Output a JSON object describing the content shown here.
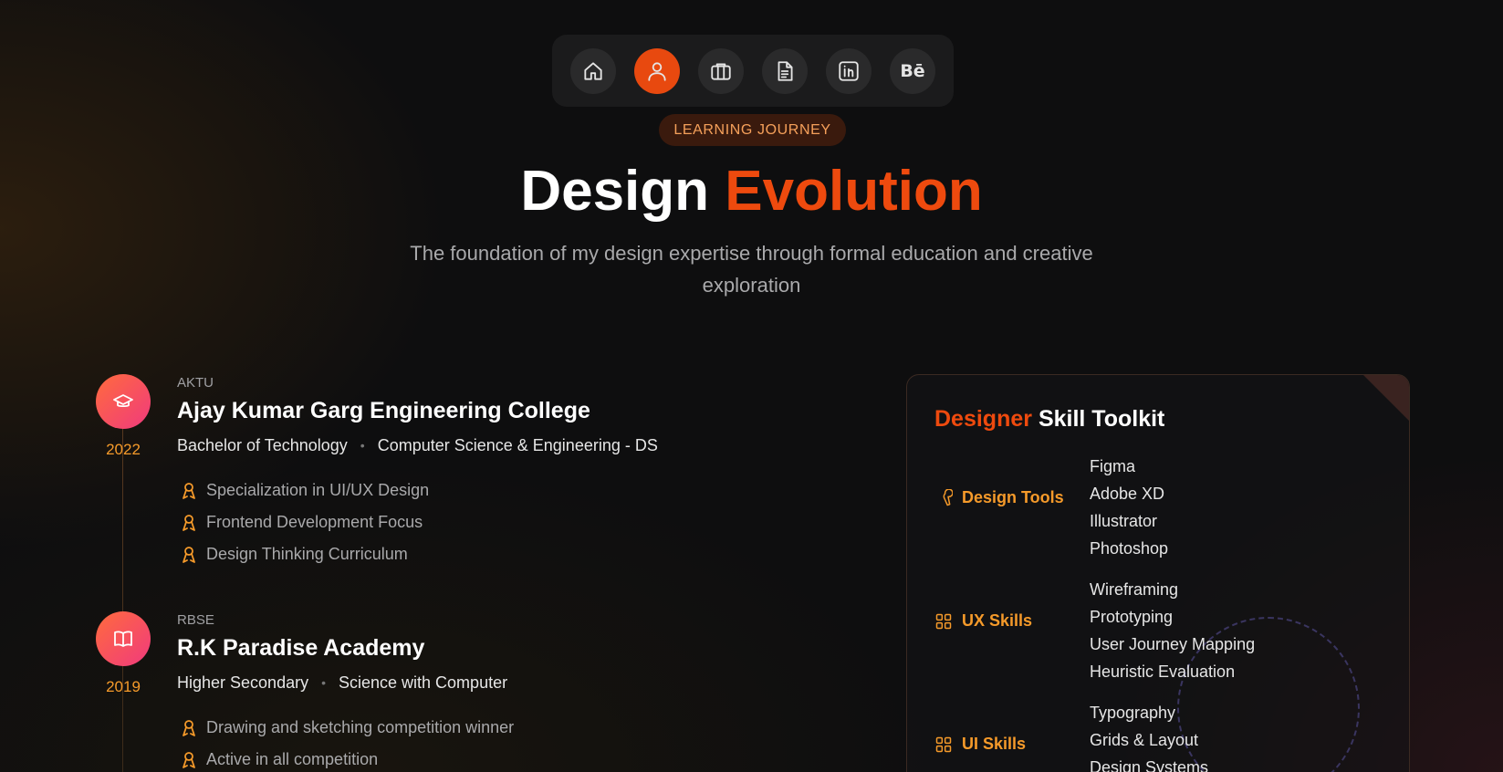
{
  "nav": {
    "items": [
      {
        "icon": "home-icon",
        "label": "Home"
      },
      {
        "icon": "user-icon",
        "label": "About",
        "active": true
      },
      {
        "icon": "briefcase-icon",
        "label": "Work"
      },
      {
        "icon": "document-icon",
        "label": "Resume"
      },
      {
        "icon": "linkedin-icon",
        "label": "LinkedIn"
      },
      {
        "icon": "behance-icon",
        "label": "Bē"
      }
    ]
  },
  "hero": {
    "badge": "LEARNING JOURNEY",
    "title_main": "Design",
    "title_accent": "Evolution",
    "subtitle": "The foundation of my design expertise through formal education and creative exploration"
  },
  "education": [
    {
      "icon": "graduation-cap-icon",
      "year": "2022",
      "board": "AKTU",
      "name": "Ajay Kumar Garg Engineering College",
      "degree": "Bachelor of Technology",
      "field": "Computer Science & Engineering - DS",
      "points": [
        "Specialization in UI/UX Design",
        "Frontend Development Focus",
        "Design Thinking Curriculum"
      ]
    },
    {
      "icon": "book-icon",
      "year": "2019",
      "board": "RBSE",
      "name": "R.K Paradise Academy",
      "degree": "Higher Secondary",
      "field": "Science with Computer",
      "points": [
        "Drawing and sketching competition winner",
        "Active in all competition"
      ]
    }
  ],
  "toolkit": {
    "title_accent": "Designer",
    "title_main": "Skill Toolkit",
    "categories": [
      {
        "icon": "wrench-icon",
        "name": "Design Tools",
        "items": [
          "Figma",
          "Adobe XD",
          "Illustrator",
          "Photoshop"
        ]
      },
      {
        "icon": "grid-icon",
        "name": "UX Skills",
        "items": [
          "Wireframing",
          "Prototyping",
          "User Journey Mapping",
          "Heuristic Evaluation"
        ]
      },
      {
        "icon": "grid-icon",
        "name": "UI Skills",
        "items": [
          "Typography",
          "Grids & Layout",
          "Design Systems"
        ]
      }
    ]
  },
  "colors": {
    "accent": "#ee4a0e",
    "gold": "#f59a2a",
    "background": "#0e0e0f"
  }
}
